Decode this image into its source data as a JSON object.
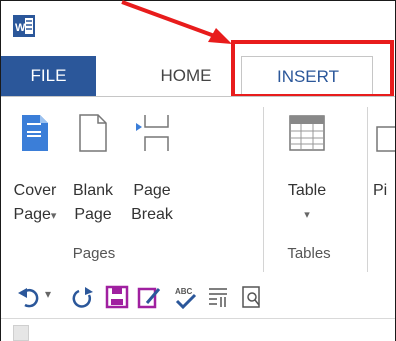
{
  "app": {
    "logo_letter": "W"
  },
  "tabs": {
    "file": "FILE",
    "home": "HOME",
    "insert": "INSERT"
  },
  "ribbon": {
    "pages": {
      "cover_page": [
        "Cover",
        "Page"
      ],
      "cover_page_dropdown": "▾",
      "blank_page": [
        "Blank",
        "Page"
      ],
      "page_break": [
        "Page",
        "Break"
      ],
      "group_label": "Pages"
    },
    "tables": {
      "table": "Table",
      "table_dropdown": "▾",
      "group_label": "Tables"
    },
    "pictures_partial": "Pi"
  },
  "colors": {
    "brand": "#2b579a",
    "highlight": "#e81c1c"
  },
  "qat_icons": [
    "undo-icon",
    "undo-dropdown-icon",
    "redo-icon",
    "save-icon",
    "edit-document-icon",
    "spelling-icon",
    "paragraph-icon",
    "print-preview-icon"
  ]
}
